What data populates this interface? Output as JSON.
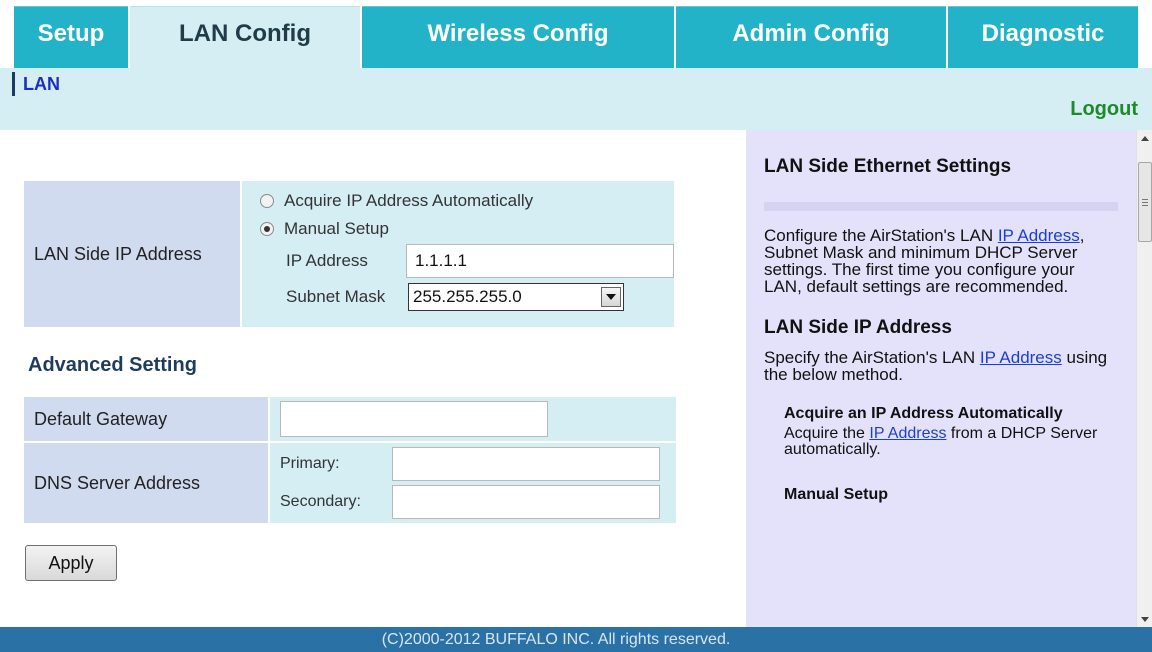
{
  "nav": {
    "tabs": [
      {
        "label": "Setup",
        "active": false
      },
      {
        "label": "LAN Config",
        "active": true
      },
      {
        "label": "Wireless Config",
        "active": false
      },
      {
        "label": "Admin Config",
        "active": false
      },
      {
        "label": "Diagnostic",
        "active": false
      }
    ]
  },
  "subnav": {
    "items": [
      {
        "label": "LAN"
      }
    ],
    "logout_label": "Logout"
  },
  "lan_ip": {
    "label": "LAN Side IP Address",
    "option_auto": "Acquire IP Address Automatically",
    "option_manual": "Manual Setup",
    "selected": "manual",
    "ip_address_label": "IP Address",
    "ip_address_value": "1.1.1.1",
    "subnet_mask_label": "Subnet Mask",
    "subnet_mask_value": "255.255.255.0"
  },
  "advanced": {
    "title": "Advanced Setting",
    "default_gateway_label": "Default Gateway",
    "default_gateway_value": "",
    "dns_label": "DNS Server Address",
    "primary_label": "Primary:",
    "primary_value": "",
    "secondary_label": "Secondary:",
    "secondary_value": ""
  },
  "apply_label": "Apply",
  "help": {
    "title": "LAN Side Ethernet Settings",
    "intro_pre": "Configure the AirStation's LAN ",
    "intro_link": "IP Address",
    "intro_post": ", Subnet Mask and minimum DHCP Server settings. The first time you configure your LAN, default settings are recommended.",
    "section_title": "LAN Side IP Address",
    "section_pre": "Specify the AirStation's LAN ",
    "section_link": "IP Address",
    "section_post": " using the below method.",
    "auto_title": "Acquire an IP Address Automatically",
    "auto_pre": "Acquire the ",
    "auto_link": "IP Address",
    "auto_post": " from a DHCP Server automatically.",
    "manual_title": "Manual Setup"
  },
  "footer": {
    "text": "(C)2000-2012 BUFFALO INC. All rights reserved."
  },
  "colors": {
    "tab": "#23b3c9",
    "subnav": "#d5eef4",
    "footer": "#2a71a6",
    "help_bg": "#e4e2fa",
    "logout": "#1e8a2a"
  }
}
